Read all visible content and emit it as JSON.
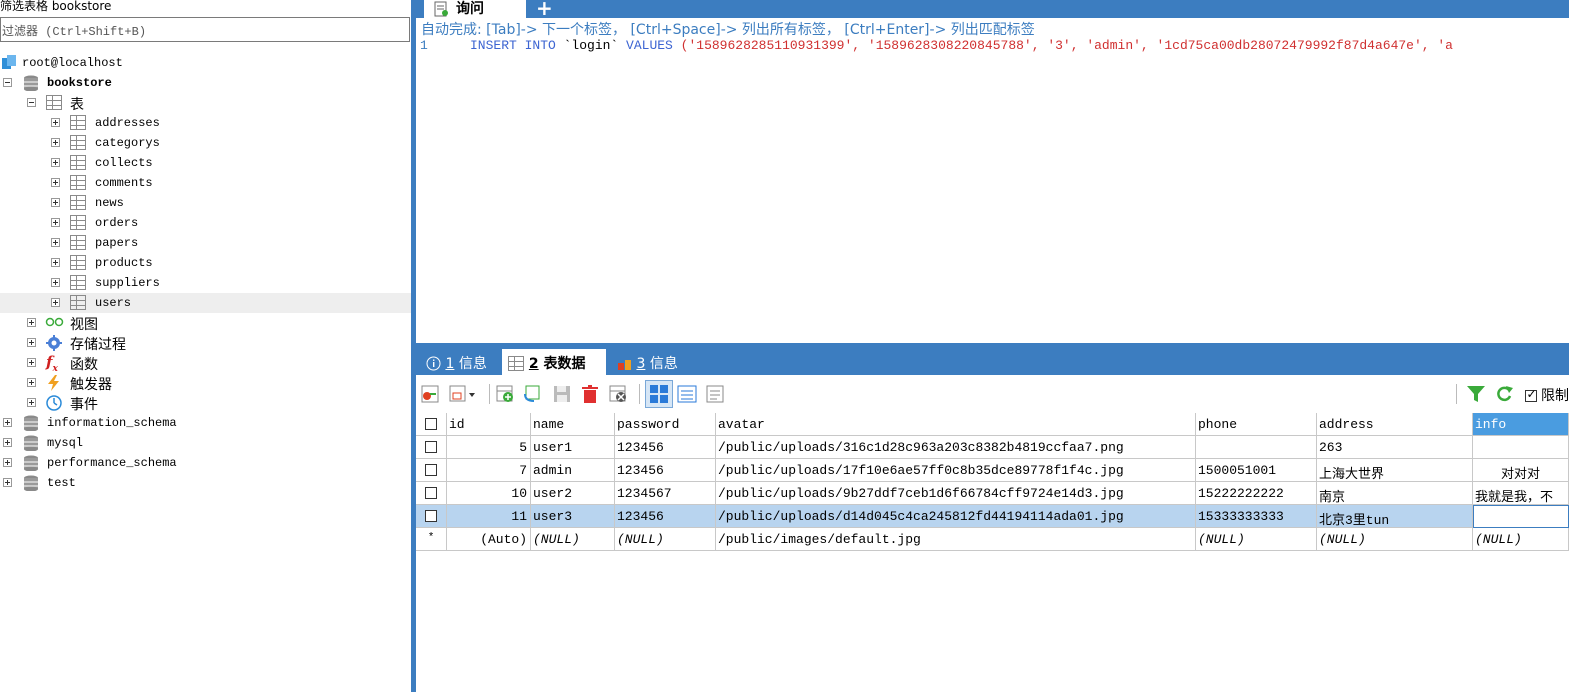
{
  "left": {
    "title": "筛选表格 bookstore",
    "filter_placeholder": "过滤器 (Ctrl+Shift+B)",
    "connection": "root@localhost",
    "database": "bookstore",
    "tables_folder": "表",
    "tables": [
      "addresses",
      "categorys",
      "collects",
      "comments",
      "news",
      "orders",
      "papers",
      "products",
      "suppliers",
      "users"
    ],
    "folders": [
      "视图",
      "存储过程",
      "函数",
      "触发器",
      "事件"
    ],
    "other_databases": [
      "information_schema",
      "mysql",
      "performance_schema",
      "test"
    ]
  },
  "query_tab": {
    "label": "询问",
    "add_label": "+"
  },
  "autocomplete_hint": "自动完成: [Tab]-> 下一个标签， [Ctrl+Space]-> 列出所有标签， [Ctrl+Enter]-> 列出匹配标签",
  "sql": {
    "line_number": "1",
    "insert": "INSERT INTO",
    "table": " `login` ",
    "values_kw": "VALUES",
    "values_text": " ('1589628285110931399', '1589628308220845788', '3', 'admin', '1cd75ca00db28072479992f87d4a647e', 'a"
  },
  "result_tabs": [
    {
      "num": "1",
      "label": "信息"
    },
    {
      "num": "2",
      "label": "表数据"
    },
    {
      "num": "3",
      "label": "信息"
    }
  ],
  "limit_label": "限制",
  "grid": {
    "columns": [
      "id",
      "name",
      "password",
      "avatar",
      "phone",
      "address",
      "info"
    ],
    "rows": [
      {
        "id": "5",
        "name": "user1",
        "password": "123456",
        "avatar": "/public/uploads/316c1d28c963a203c8382b4819ccfaa7.png",
        "phone": "",
        "address": "263",
        "info": ""
      },
      {
        "id": "7",
        "name": "admin",
        "password": "123456",
        "avatar": "/public/uploads/17f10e6ae57ff0c8b35dce89778f1f4c.jpg",
        "phone": "1500051001",
        "address": "上海大世界",
        "info": "对对对"
      },
      {
        "id": "10",
        "name": "user2",
        "password": "1234567",
        "avatar": "/public/uploads/9b27ddf7ceb1d6f66784cff9724e14d3.jpg",
        "phone": "15222222222",
        "address": "南京",
        "info": "我就是我，不"
      },
      {
        "id": "11",
        "name": "user3",
        "password": "123456",
        "avatar": "/public/uploads/d14d045c4ca245812fd44194114ada01.jpg",
        "phone": "15333333333",
        "address": "北京3里tun",
        "info": ""
      }
    ],
    "new_row": {
      "marker": "*",
      "id": "(Auto)",
      "name": "(NULL)",
      "password": "(NULL)",
      "avatar": "/public/images/default.jpg",
      "phone": "(NULL)",
      "address": "(NULL)",
      "info": "(NULL)"
    }
  },
  "colors": {
    "accent": "#3c7dc0",
    "selection": "#b8d4ef",
    "keyword": "#3c64d2",
    "string": "#d03030"
  }
}
